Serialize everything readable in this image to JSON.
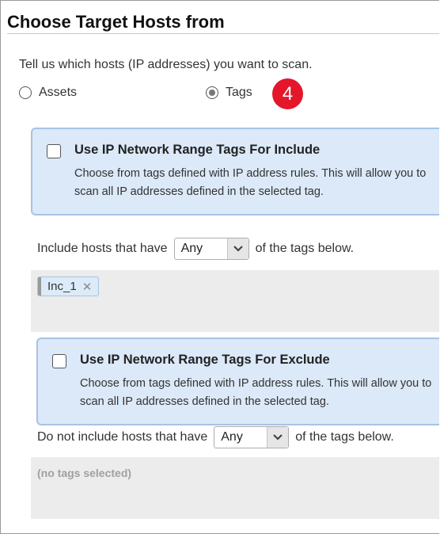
{
  "header": {
    "title": "Choose Target Hosts from"
  },
  "prompt": "Tell us which hosts (IP addresses) you want to scan.",
  "target_options": [
    {
      "label": "Assets",
      "selected": false
    },
    {
      "label": "Tags",
      "selected": true
    }
  ],
  "step_badge": "4",
  "include": {
    "heading": "Use IP Network Range Tags For Include",
    "description": "Choose from tags defined with IP address rules. This will allow you to scan all IP addresses defined in the selected tag.",
    "checked": false,
    "filter_prefix": "Include hosts that have",
    "match_value": "Any",
    "filter_suffix": "of the tags below.",
    "tags": [
      "Inc_1"
    ]
  },
  "exclude": {
    "heading": "Use IP Network Range Tags For Exclude",
    "description": "Choose from tags defined with IP address rules. This will allow you to scan all IP addresses defined in the selected tag.",
    "checked": false,
    "filter_prefix": "Do not include hosts that have",
    "match_value": "Any",
    "filter_suffix": "of the tags below.",
    "empty_text": "(no tags selected)"
  },
  "icons": {
    "remove_tag": "close-icon",
    "dropdown": "chevron-down-icon"
  },
  "colors": {
    "badge": "#e4162a",
    "panel_bg": "#dbe9f8",
    "panel_border": "#a6c3e4",
    "tag_area_bg": "#ececec"
  }
}
